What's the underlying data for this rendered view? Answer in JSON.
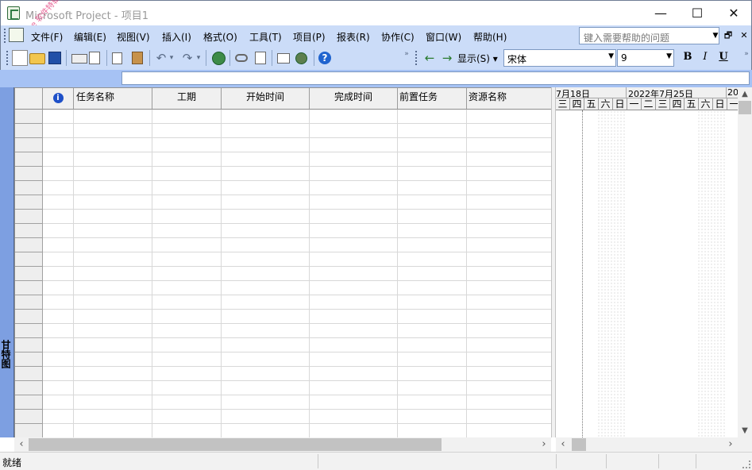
{
  "window": {
    "title": "Microsoft Project - 项目1",
    "minimize": "—",
    "maximize": "☐",
    "close": "✕",
    "watermark": "ACDSee 软件特辑"
  },
  "menu": {
    "items": [
      "文件(F)",
      "编辑(E)",
      "视图(V)",
      "插入(I)",
      "格式(O)",
      "工具(T)",
      "项目(P)",
      "报表(R)",
      "协作(C)",
      "窗口(W)",
      "帮助(H)"
    ],
    "help_placeholder": "键入需要帮助的问题",
    "restore": "🗗",
    "close": "✕"
  },
  "toolbar": {
    "show_label": "显示(S) ▾",
    "font": "宋体",
    "font_size": "9",
    "bold": "B",
    "italic": "I",
    "underline": "U",
    "help_icon": "?"
  },
  "grid": {
    "info_icon": "i",
    "columns": [
      "任务名称",
      "工期",
      "开始时间",
      "完成时间",
      "前置任务",
      "资源名称"
    ],
    "row_count": 23
  },
  "view": {
    "label": "甘特图"
  },
  "gantt": {
    "week1": "7月18日",
    "week2": "2022年7月25日",
    "week3": "20",
    "days": [
      "三",
      "四",
      "五",
      "六",
      "日",
      "一",
      "二",
      "三",
      "四",
      "五",
      "六",
      "日",
      "一"
    ]
  },
  "status": {
    "text": "就绪"
  }
}
